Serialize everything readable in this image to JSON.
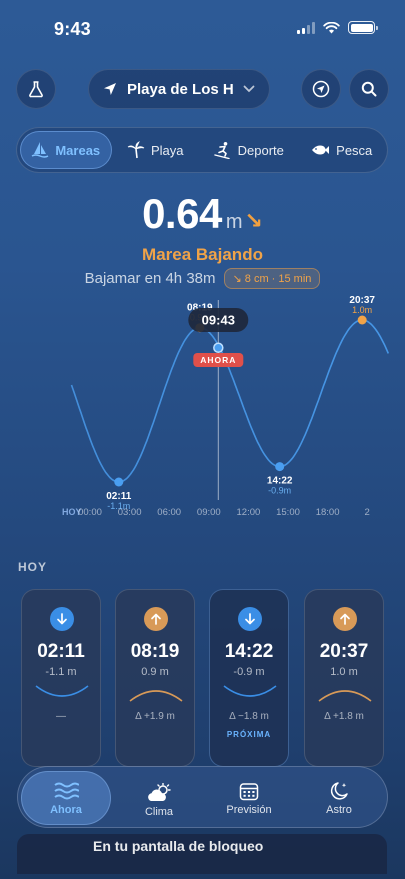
{
  "status": {
    "time": "9:43"
  },
  "header": {
    "location_label": "Playa de Los H...",
    "lab_icon": "flask-icon",
    "gps_icon": "navigation-arrow-icon",
    "search_icon": "search-icon"
  },
  "tabs": [
    {
      "label": "Mareas",
      "icon": "sailboat-icon",
      "active": true
    },
    {
      "label": "Playa",
      "icon": "palm-tree-icon",
      "active": false
    },
    {
      "label": "Deporte",
      "icon": "skier-icon",
      "active": false
    },
    {
      "label": "Pesca",
      "icon": "fish-icon",
      "active": false
    }
  ],
  "hero": {
    "value": "0.64",
    "unit": "m",
    "trend_arrow": "↘",
    "state": "Marea Bajando",
    "low_tide_in": "Bajamar en 4h 38m",
    "rate": "↘ 8 cm · 15 min"
  },
  "tide_chart": {
    "now_time": "09:43",
    "now_label": "AHORA",
    "x_axis_prefix": "HOY",
    "x_ticks": [
      "00:00",
      "03:00",
      "06:00",
      "09:00",
      "12:00",
      "15:00",
      "18:00",
      "2"
    ],
    "extremes": [
      {
        "time": "02:11",
        "height": "-1.1m",
        "hour": 2.18,
        "value": -1.1,
        "type": "low"
      },
      {
        "time": "08:19",
        "height": "0.9m",
        "hour": 8.32,
        "value": 0.9,
        "type": "high"
      },
      {
        "time": "14:22",
        "height": "-0.9m",
        "hour": 14.37,
        "value": -0.9,
        "type": "low"
      },
      {
        "time": "20:37",
        "height": "1.0m",
        "hour": 20.62,
        "value": 1.0,
        "type": "high"
      }
    ],
    "now_hour": 9.72,
    "now_value": 0.64
  },
  "section_title": "HOY",
  "tide_cards": [
    {
      "time": "02:11",
      "height": "-1.1 m",
      "type": "low",
      "delta": "—",
      "next_label": ""
    },
    {
      "time": "08:19",
      "height": "0.9 m",
      "type": "high",
      "delta": "Δ +1.9 m",
      "next_label": ""
    },
    {
      "time": "14:22",
      "height": "-0.9 m",
      "type": "low",
      "delta": "Δ −1.8 m",
      "next_label": "PRÓXIMA"
    },
    {
      "time": "20:37",
      "height": "1.0 m",
      "type": "high",
      "delta": "Δ +1.8 m",
      "next_label": ""
    }
  ],
  "lock_screen_text": "En tu pantalla de bloqueo",
  "bottom_nav": [
    {
      "label": "Ahora",
      "icon": "waves-icon",
      "active": true
    },
    {
      "label": "Clima",
      "icon": "cloud-sun-icon",
      "active": false
    },
    {
      "label": "Previsión",
      "icon": "calendar-icon",
      "active": false
    },
    {
      "label": "Astro",
      "icon": "moon-stars-icon",
      "active": false
    }
  ],
  "colors": {
    "accent_blue": "#4a9ef0",
    "accent_orange": "#f0a348",
    "now_red": "#e0504a"
  }
}
